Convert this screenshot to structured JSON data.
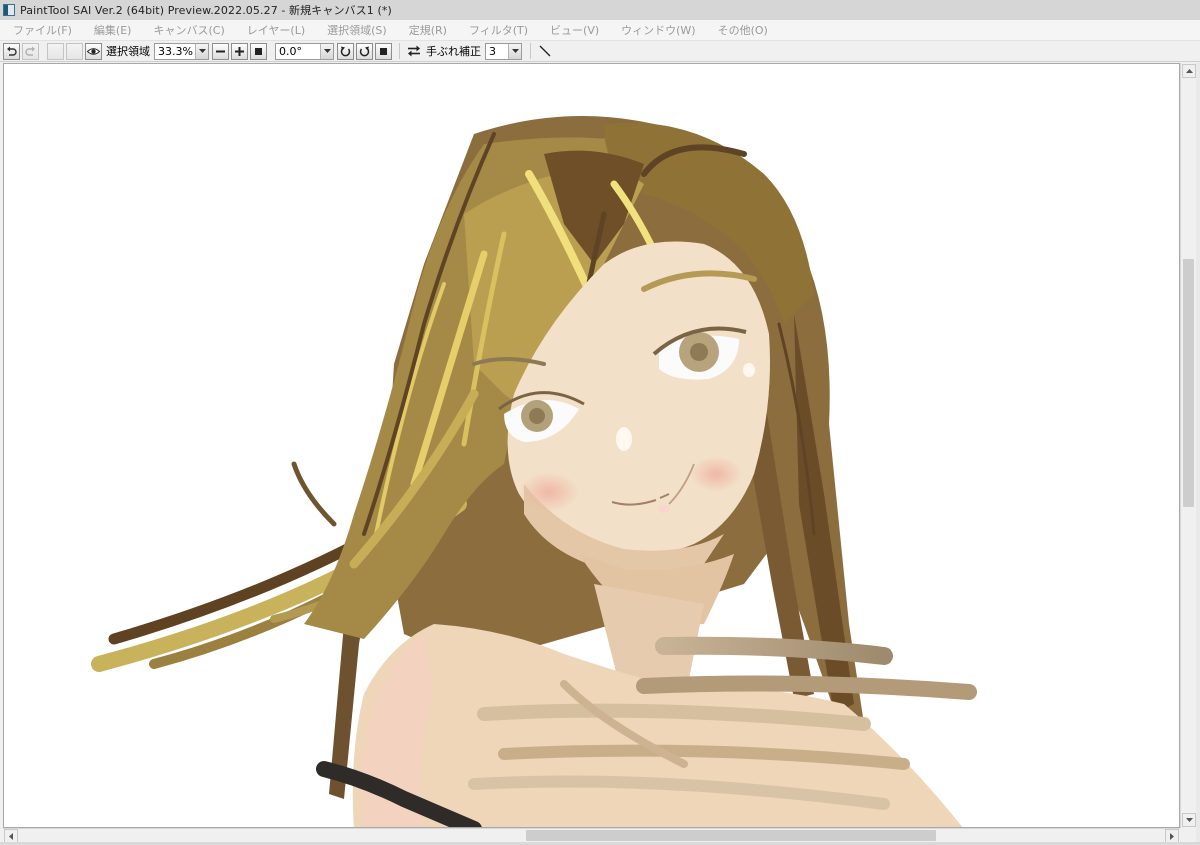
{
  "window": {
    "title": "PaintTool SAI Ver.2 (64bit) Preview.2022.05.27 - 新規キャンバス1 (*)"
  },
  "menu": [
    "ファイル(F)",
    "編集(E)",
    "キャンバス(C)",
    "レイヤー(L)",
    "選択領域(S)",
    "定規(R)",
    "フィルタ(T)",
    "ビュー(V)",
    "ウィンドウ(W)",
    "その他(O)"
  ],
  "toolbar": {
    "selection_label": "選択領域",
    "zoom_value": "33.3%",
    "rotation_value": "0.0°",
    "stabilizer_label": "手ぶれ補正",
    "stabilizer_value": "3"
  },
  "icons": [
    "undo-icon",
    "redo-icon",
    "eye-icon",
    "zoom-out-icon",
    "zoom-in-icon",
    "zoom-reset-icon",
    "rotate-left-icon",
    "rotate-right-icon",
    "rotate-reset-icon",
    "flip-horizontal-icon",
    "line-tool-icon"
  ],
  "colors": {
    "hair_dark": "#6e4e2a",
    "hair_mid": "#9b8140",
    "hair_light": "#c8b05e",
    "hair_highlight": "#f0de78",
    "skin": "#f2dcc2",
    "skin_shadow": "#e2c4a4",
    "blush": "#f0b8a8",
    "iris": "#a89570"
  }
}
